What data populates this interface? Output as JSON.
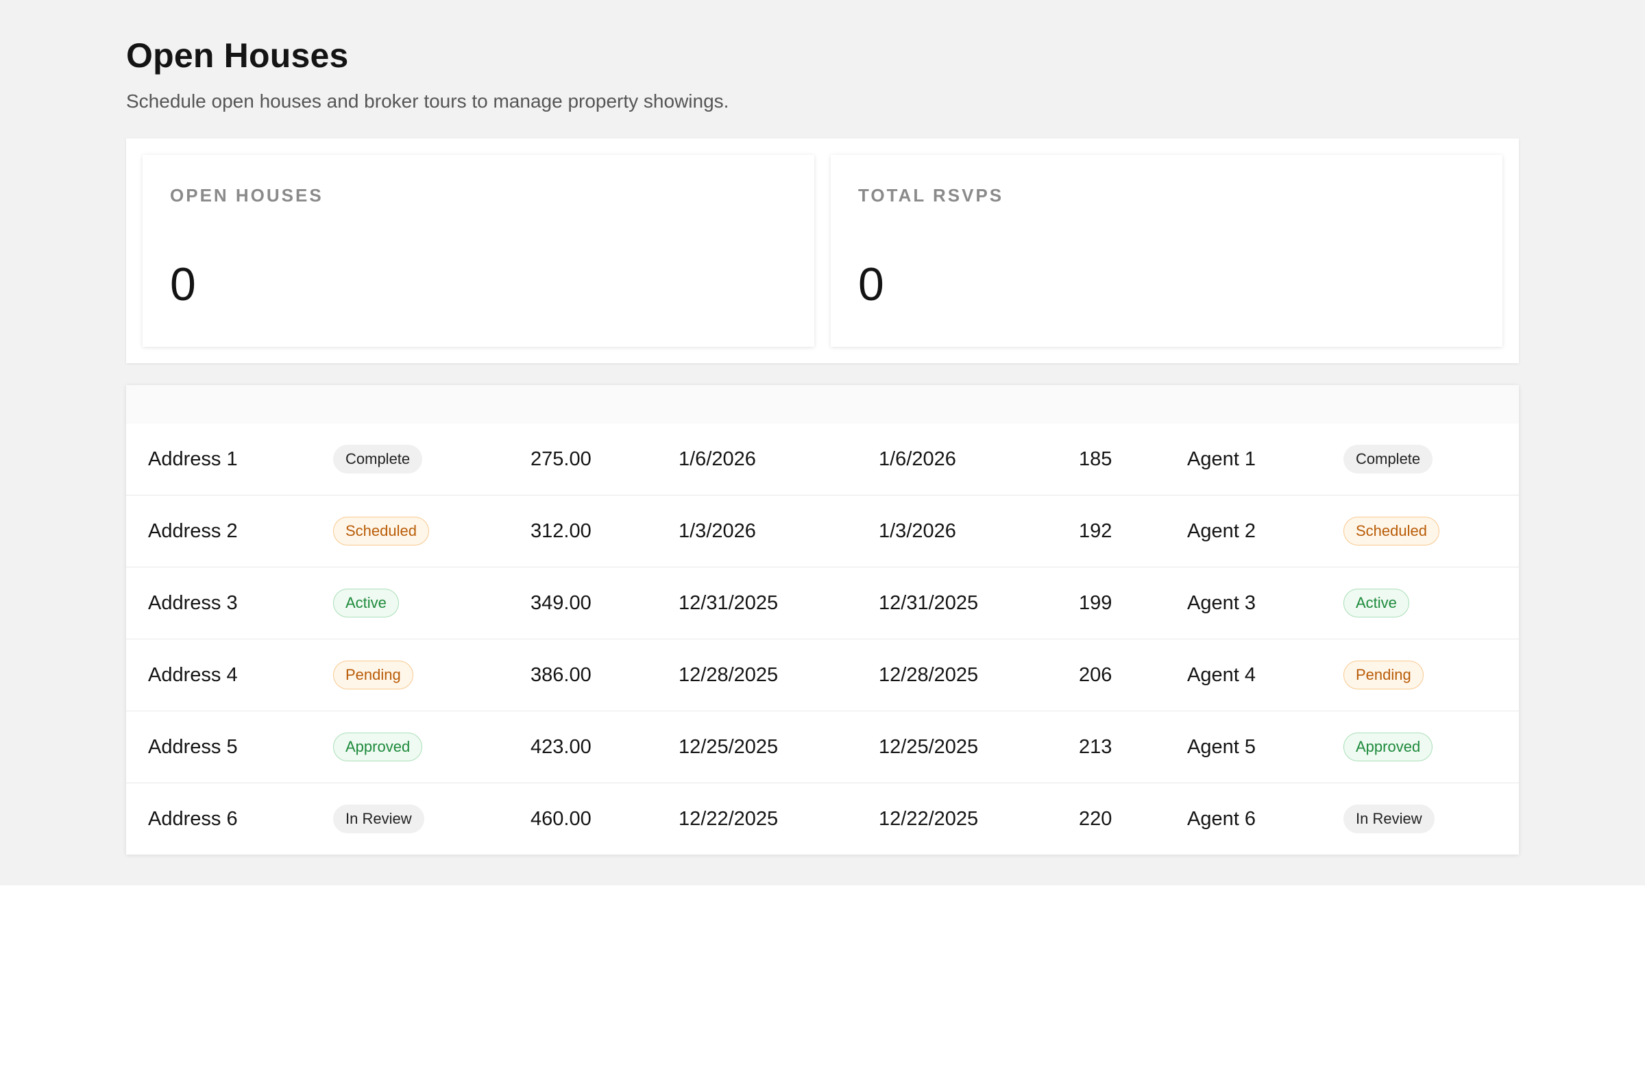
{
  "header": {
    "title": "Open Houses",
    "subtitle": "Schedule open houses and broker tours to manage property showings."
  },
  "stats": [
    {
      "label": "OPEN HOUSES",
      "value": "0"
    },
    {
      "label": "TOTAL RSVPS",
      "value": "0"
    }
  ],
  "colors": {
    "page_background": "#f2f2f2",
    "card_background": "#ffffff",
    "badge_warning": "#b85c06",
    "badge_success": "#1d8a3b",
    "badge_neutral": "#222222"
  },
  "table": {
    "rows": [
      {
        "address": "Address 1",
        "status": "Complete",
        "price": "275.00",
        "date1": "1/6/2026",
        "date2": "1/6/2026",
        "count": "185",
        "agent": "Agent 1",
        "status2": "Complete"
      },
      {
        "address": "Address 2",
        "status": "Scheduled",
        "price": "312.00",
        "date1": "1/3/2026",
        "date2": "1/3/2026",
        "count": "192",
        "agent": "Agent 2",
        "status2": "Scheduled"
      },
      {
        "address": "Address 3",
        "status": "Active",
        "price": "349.00",
        "date1": "12/31/2025",
        "date2": "12/31/2025",
        "count": "199",
        "agent": "Agent 3",
        "status2": "Active"
      },
      {
        "address": "Address 4",
        "status": "Pending",
        "price": "386.00",
        "date1": "12/28/2025",
        "date2": "12/28/2025",
        "count": "206",
        "agent": "Agent 4",
        "status2": "Pending"
      },
      {
        "address": "Address 5",
        "status": "Approved",
        "price": "423.00",
        "date1": "12/25/2025",
        "date2": "12/25/2025",
        "count": "213",
        "agent": "Agent 5",
        "status2": "Approved"
      },
      {
        "address": "Address 6",
        "status": "In Review",
        "price": "460.00",
        "date1": "12/22/2025",
        "date2": "12/22/2025",
        "count": "220",
        "agent": "Agent 6",
        "status2": "In Review"
      }
    ]
  }
}
